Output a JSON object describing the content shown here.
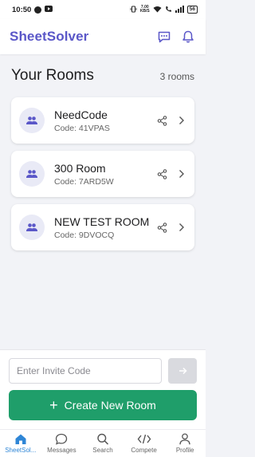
{
  "status_bar": {
    "time": "10:50",
    "network_top": "7.00",
    "network_bottom": "KB/S",
    "battery": "56"
  },
  "header": {
    "app_title": "SheetSolver"
  },
  "rooms_section": {
    "title": "Your Rooms",
    "count_text": "3 rooms"
  },
  "rooms": [
    {
      "name": "NeedCode",
      "code_text": "Code: 41VPAS"
    },
    {
      "name": "300 Room",
      "code_text": "Code: 7ARD5W"
    },
    {
      "name": "NEW TEST ROOM",
      "code_text": "Code: 9DVOCQ"
    }
  ],
  "invite": {
    "placeholder": "Enter Invite Code"
  },
  "create_button": {
    "label": "Create New Room"
  },
  "tabs": [
    {
      "label": "SheetSol...",
      "icon": "home-icon",
      "active": true
    },
    {
      "label": "Messages",
      "icon": "chat-icon",
      "active": false
    },
    {
      "label": "Search",
      "icon": "search-icon",
      "active": false
    },
    {
      "label": "Compete",
      "icon": "code-icon",
      "active": false
    },
    {
      "label": "Profile",
      "icon": "person-icon",
      "active": false
    }
  ],
  "colors": {
    "brand": "#5a57c8",
    "primary_green": "#1f9e6a",
    "active_tab": "#2f86d6"
  }
}
